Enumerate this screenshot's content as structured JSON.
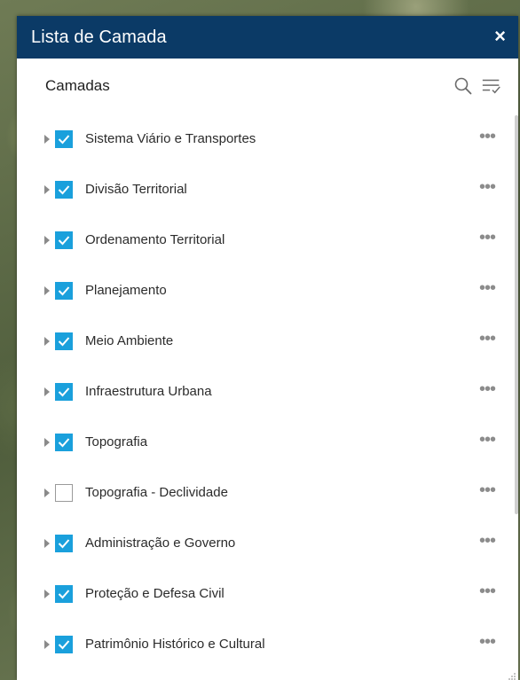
{
  "panel": {
    "title": "Lista de Camada",
    "close_label": "×",
    "section_title": "Camadas"
  },
  "icons": {
    "search": "search-icon",
    "filter": "filter-list-icon",
    "more": "more-options-icon",
    "expand": "caret-right-icon"
  },
  "more_label": "•••",
  "layers": [
    {
      "label": "Sistema Viário e Transportes",
      "checked": true
    },
    {
      "label": "Divisão Territorial",
      "checked": true
    },
    {
      "label": "Ordenamento Territorial",
      "checked": true
    },
    {
      "label": "Planejamento",
      "checked": true
    },
    {
      "label": "Meio Ambiente",
      "checked": true
    },
    {
      "label": "Infraestrutura Urbana",
      "checked": true
    },
    {
      "label": "Topografia",
      "checked": true
    },
    {
      "label": "Topografia - Declividade",
      "checked": false
    },
    {
      "label": "Administração e Governo",
      "checked": true
    },
    {
      "label": "Proteção e Defesa Civil",
      "checked": true
    },
    {
      "label": "Patrimônio Histórico e Cultural",
      "checked": true
    }
  ],
  "colors": {
    "header_bg": "#0b3a66",
    "checkbox_checked": "#1aa0dc"
  }
}
